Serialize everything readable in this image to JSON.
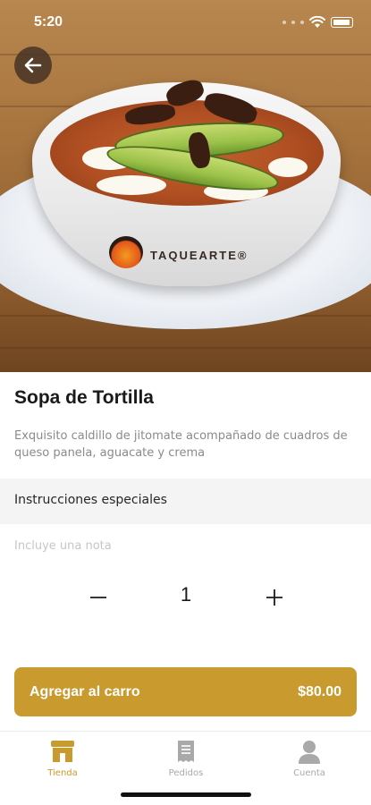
{
  "status_bar": {
    "time": "5:20"
  },
  "hero": {
    "brand_logo_text": "TAQUEARTE®"
  },
  "product": {
    "name": "Sopa de Tortilla",
    "description": "Exquisito caldillo de jitomate acompañado de cuadros de queso panela, aguacate y crema"
  },
  "instructions": {
    "label": "Instrucciones especiales",
    "placeholder": "Incluye una nota"
  },
  "quantity": {
    "minus_symbol": "−",
    "value": "1",
    "plus_symbol": "+"
  },
  "cart_button": {
    "label": "Agregar al carro",
    "price": "$80.00"
  },
  "tabs": [
    {
      "label": "Tienda",
      "icon": "store-icon",
      "active": true
    },
    {
      "label": "Pedidos",
      "icon": "receipt-icon",
      "active": false
    },
    {
      "label": "Cuenta",
      "icon": "user-icon",
      "active": false
    }
  ],
  "colors": {
    "accent": "#c99a2e",
    "active_tab": "#c99a2e",
    "inactive_tab": "#a9a9a9"
  }
}
